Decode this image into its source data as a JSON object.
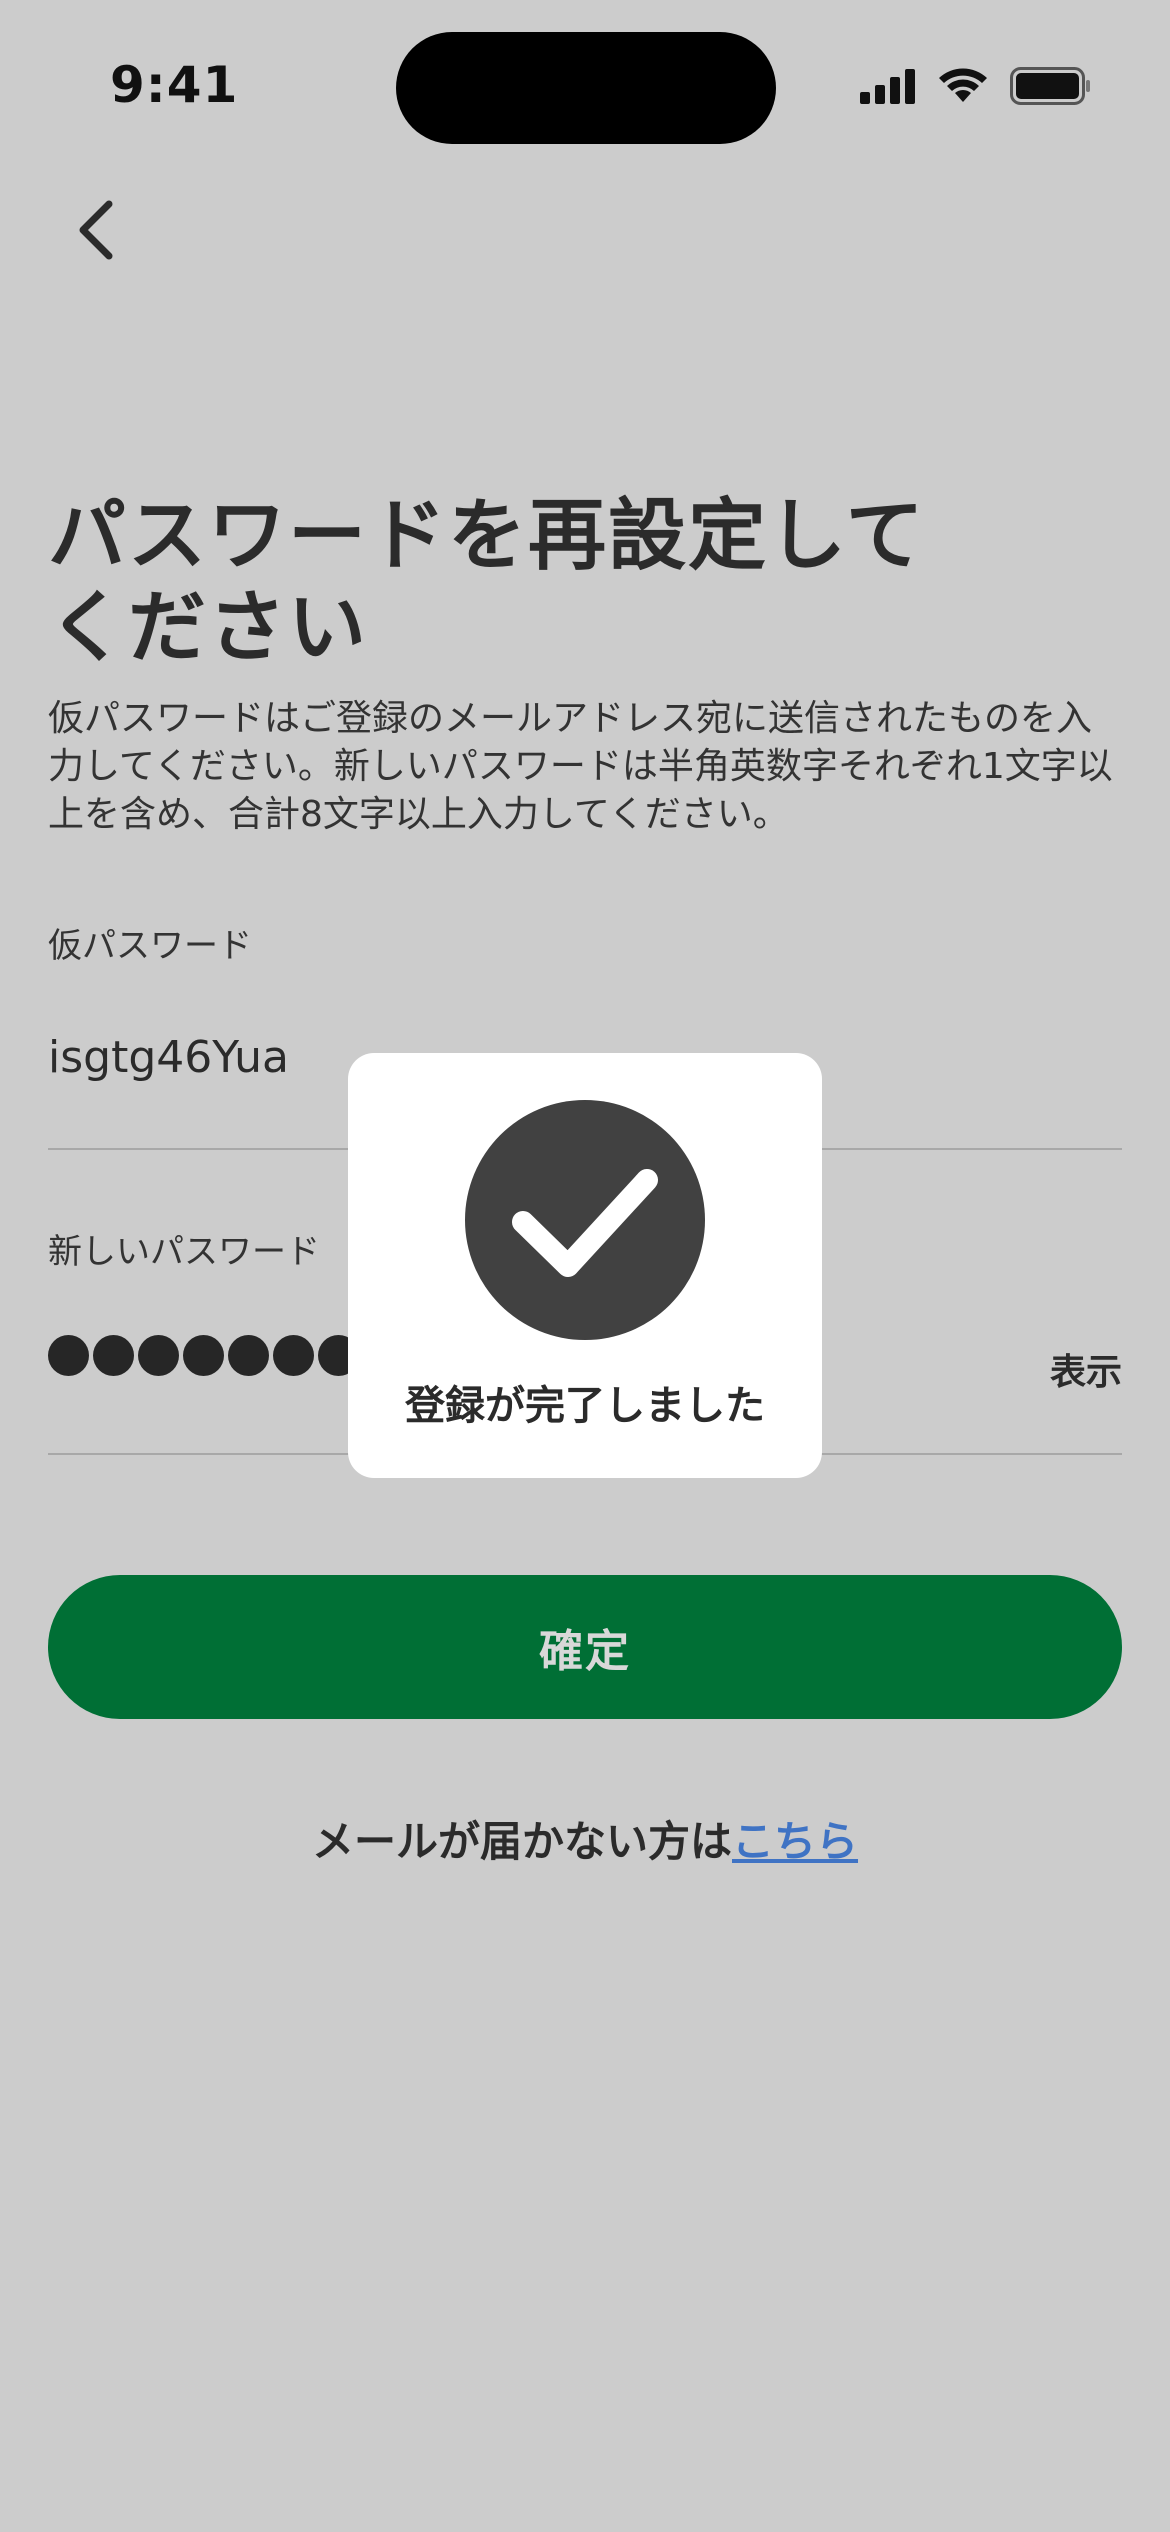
{
  "status_bar": {
    "time": "9:41"
  },
  "header": {
    "title": "パスワードを再設定して\nください"
  },
  "description": "仮パスワードはご登録のメールアドレス宛に送信されたものを入力してください。新しいパスワードは半角英数字それぞれ1文字以上を含め、合計8文字以上入力してください。",
  "temp_password": {
    "label": "仮パスワード",
    "value": "isgtg46Yua"
  },
  "new_password": {
    "label": "新しいパスワード",
    "masked_length": 7,
    "show_label": "表示"
  },
  "confirm_button": {
    "label": "確定"
  },
  "help": {
    "text": "メールが届かない方は",
    "link": "こちら"
  },
  "toast": {
    "message": "登録が完了しました",
    "icon": "checkmark-icon"
  },
  "colors": {
    "background": "#cccccc",
    "accent_green": "#006f35",
    "link_blue": "#3f73c4"
  }
}
